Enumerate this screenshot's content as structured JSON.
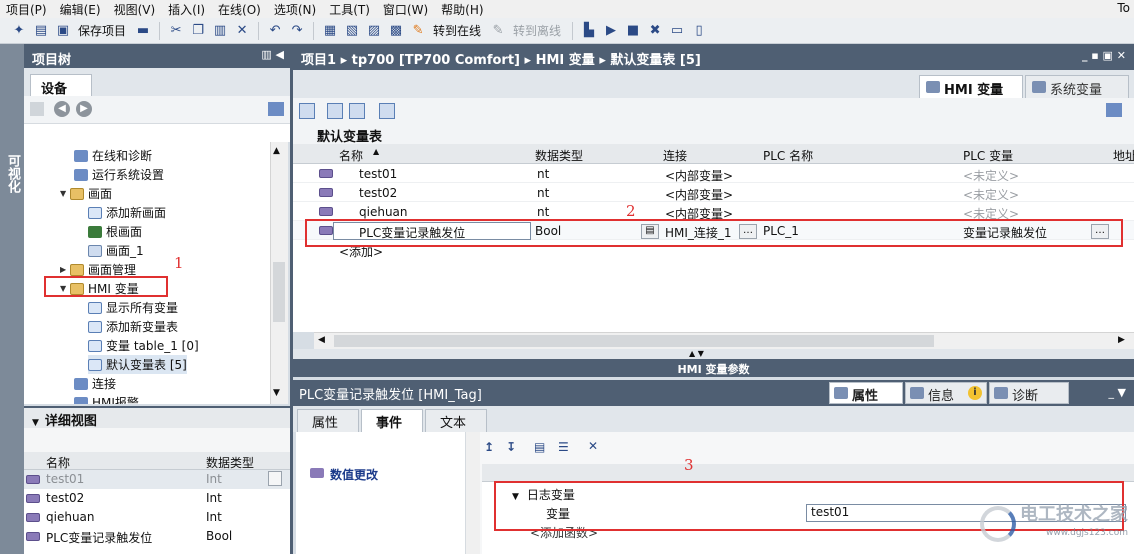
{
  "menu": [
    "项目(P)",
    "编辑(E)",
    "视图(V)",
    "插入(I)",
    "在线(O)",
    "选项(N)",
    "工具(T)",
    "窗口(W)",
    "帮助(H)"
  ],
  "menu_right": "To",
  "toolbar": {
    "save_label": "保存项目",
    "go_online": "转到在线",
    "go_offline": "转到离线"
  },
  "side_tab": "可视化",
  "project_tree": {
    "title": "项目树",
    "device_tab": "设备",
    "items": [
      {
        "label": "在线和诊断",
        "icon": "diagnostics-icon"
      },
      {
        "label": "运行系统设置",
        "icon": "runtime-settings-icon"
      },
      {
        "label": "画面",
        "icon": "folder-icon"
      },
      {
        "label": "添加新画面",
        "icon": "add-screen-icon"
      },
      {
        "label": "根画面",
        "icon": "screen-icon"
      },
      {
        "label": "画面_1",
        "icon": "screen-icon"
      },
      {
        "label": "画面管理",
        "icon": "folder-icon"
      },
      {
        "label": "HMI 变量",
        "icon": "folder-icon"
      },
      {
        "label": "显示所有变量",
        "icon": "tag-list-icon"
      },
      {
        "label": "添加新变量表",
        "icon": "add-tag-table-icon"
      },
      {
        "label": "变量 table_1 [0]",
        "icon": "tag-table-icon"
      },
      {
        "label": "默认变量表 [5]",
        "icon": "tag-table-icon"
      },
      {
        "label": "连接",
        "icon": "connection-icon"
      },
      {
        "label": "HMI报警",
        "icon": "alarm-icon"
      }
    ]
  },
  "detail_view": {
    "title": "详细视图",
    "columns": [
      "名称",
      "数据类型"
    ],
    "rows": [
      {
        "name": "test01",
        "type": "Int"
      },
      {
        "name": "test02",
        "type": "Int"
      },
      {
        "name": "qiehuan",
        "type": "Int"
      },
      {
        "name": "PLC变量记录触发位",
        "type": "Bool"
      }
    ]
  },
  "editor": {
    "breadcrumb": [
      "项目1",
      "tp700 [TP700 Comfort]",
      "HMI 变量",
      "默认变量表 [5]"
    ],
    "tabs": [
      "HMI 变量",
      "系统变量"
    ],
    "table_title": "默认变量表",
    "columns": [
      "名称",
      "数据类型",
      "连接",
      "PLC 名称",
      "PLC 变量",
      "地址"
    ],
    "rows": [
      {
        "name": "test01",
        "type": "nt",
        "conn": "<内部变量>",
        "plc": "",
        "plc_var": "<未定义>"
      },
      {
        "name": "test02",
        "type": "nt",
        "conn": "<内部变量>",
        "plc": "",
        "plc_var": "<未定义>"
      },
      {
        "name": "qiehuan",
        "type": "nt",
        "conn": "<内部变量>",
        "plc": "",
        "plc_var": "<未定义>"
      },
      {
        "name": "PLC变量记录触发位",
        "type": "Bool",
        "conn": "HMI_连接_1",
        "plc": "PLC_1",
        "plc_var": "变量记录触发位"
      }
    ],
    "add_row": "<添加>",
    "params_label": "HMI 变量参数"
  },
  "inspector": {
    "title": "PLC变量记录触发位 [HMI_Tag]",
    "tabs": [
      "属性",
      "信息",
      "诊断"
    ],
    "subtabs": [
      "属性",
      "事件",
      "文本"
    ],
    "event_item": "数值更改",
    "group": "日志变量",
    "var_label": "变量",
    "var_value": "test01",
    "add_function": "<添加函数>"
  },
  "annotations": [
    "1",
    "2",
    "3"
  ],
  "watermark": {
    "main": "电工技术之家",
    "sub": "www.dgjs123.com"
  },
  "colors": {
    "panel_header": "#4f5f73",
    "annotation_red": "#e03030",
    "selection": "#dbe6f2"
  }
}
